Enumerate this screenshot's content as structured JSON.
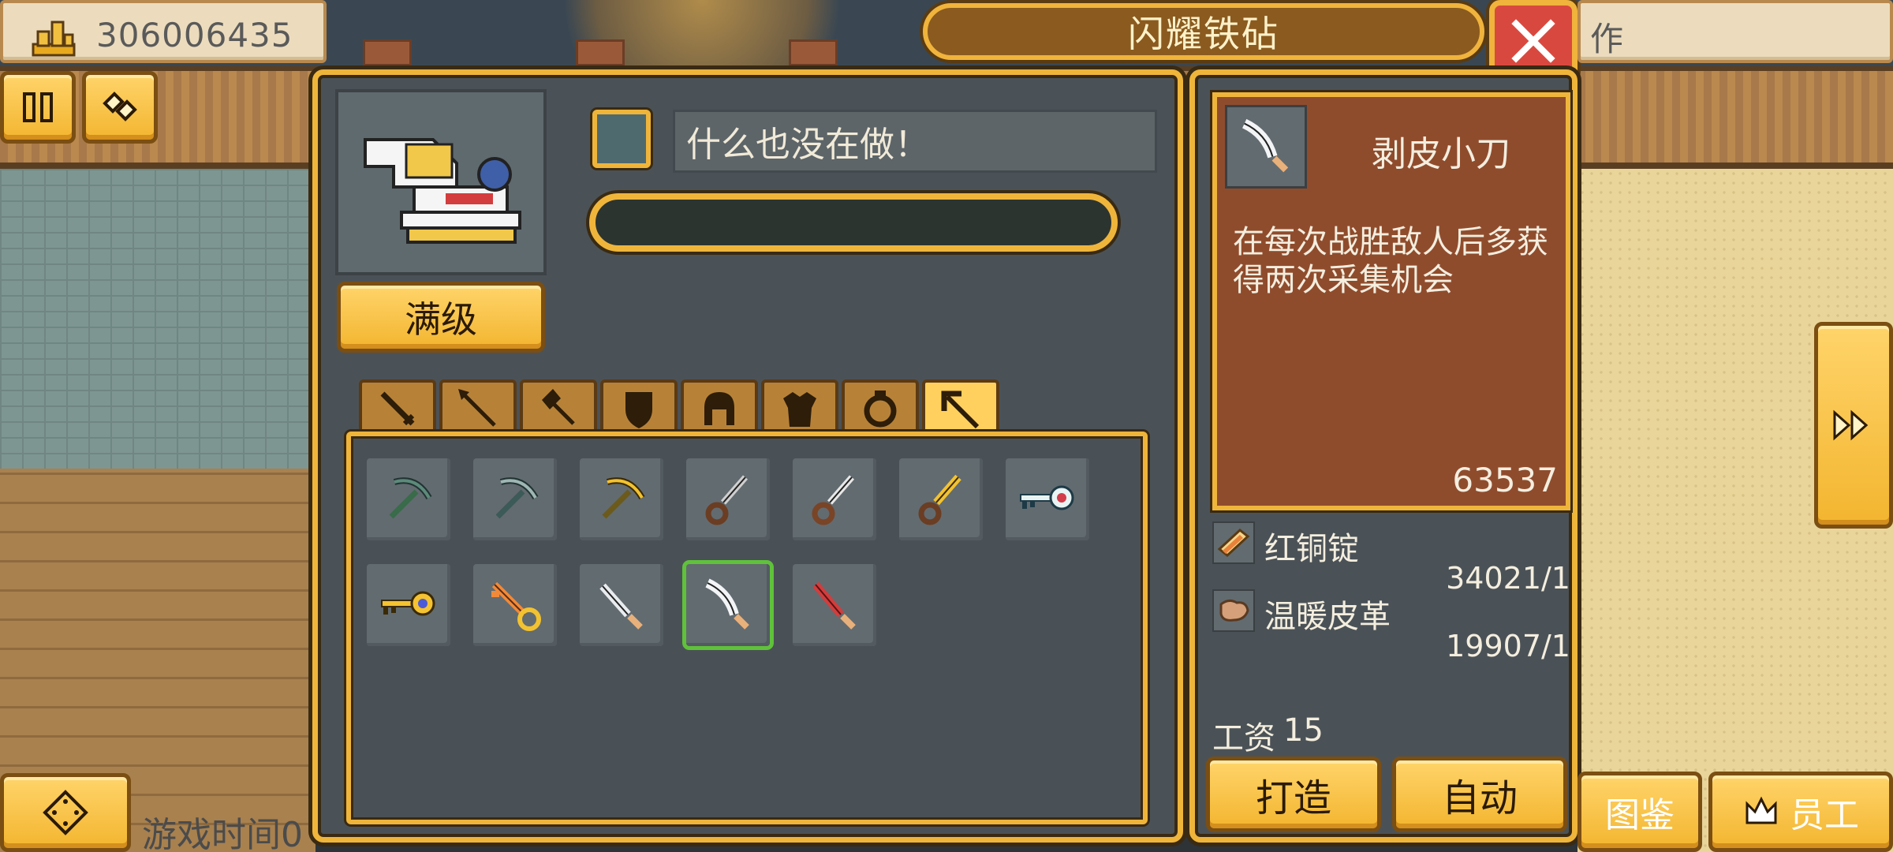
{
  "top_bar": {
    "money_value": "306006435",
    "right_tab_label": "作"
  },
  "dialog": {
    "title": "闪耀铁砧",
    "status_text": "什么也没在做！",
    "level_button_label": "满级",
    "tabs": [
      {
        "icon": "sword-icon"
      },
      {
        "icon": "spear-icon"
      },
      {
        "icon": "axe-icon"
      },
      {
        "icon": "shield-icon"
      },
      {
        "icon": "helmet-icon"
      },
      {
        "icon": "armor-icon"
      },
      {
        "icon": "ring-icon"
      },
      {
        "icon": "tool-icon",
        "active": true
      }
    ],
    "inventory": [
      {
        "icon": "pickaxe-green-icon"
      },
      {
        "icon": "pickaxe-steel-icon"
      },
      {
        "icon": "pickaxe-gold-icon"
      },
      {
        "icon": "dagger-bronze-icon"
      },
      {
        "icon": "dagger-copper-icon"
      },
      {
        "icon": "dagger-gold-icon"
      },
      {
        "icon": "key-red-icon"
      },
      {
        "icon": "key-gold-icon"
      },
      {
        "icon": "key-copper-icon"
      },
      {
        "icon": "knife-steel-icon"
      },
      {
        "icon": "skinning-knife-icon",
        "selected": true
      },
      {
        "icon": "knife-red-icon"
      }
    ]
  },
  "detail": {
    "item_name": "剥皮小刀",
    "description": "在每次战胜敌人后多获得两次采集机会",
    "count": "63537",
    "materials": [
      {
        "name": "红铜锭",
        "qty": "34021/1",
        "icon": "copper-ingot-icon"
      },
      {
        "name": "温暖皮革",
        "qty": "19907/1",
        "icon": "leather-icon"
      }
    ],
    "wage_label": "工资",
    "wage_value": "15",
    "craft_label": "打造",
    "auto_label": "自动"
  },
  "bottom": {
    "game_time_label": "游戏时间0",
    "codex_label": "图鉴",
    "staff_label": "员工"
  },
  "colors": {
    "gold": "#efb53b",
    "panel": "#4b5257",
    "card": "#8f4c2d",
    "close_red": "#d9483f",
    "selected_green": "#5fc23a"
  }
}
